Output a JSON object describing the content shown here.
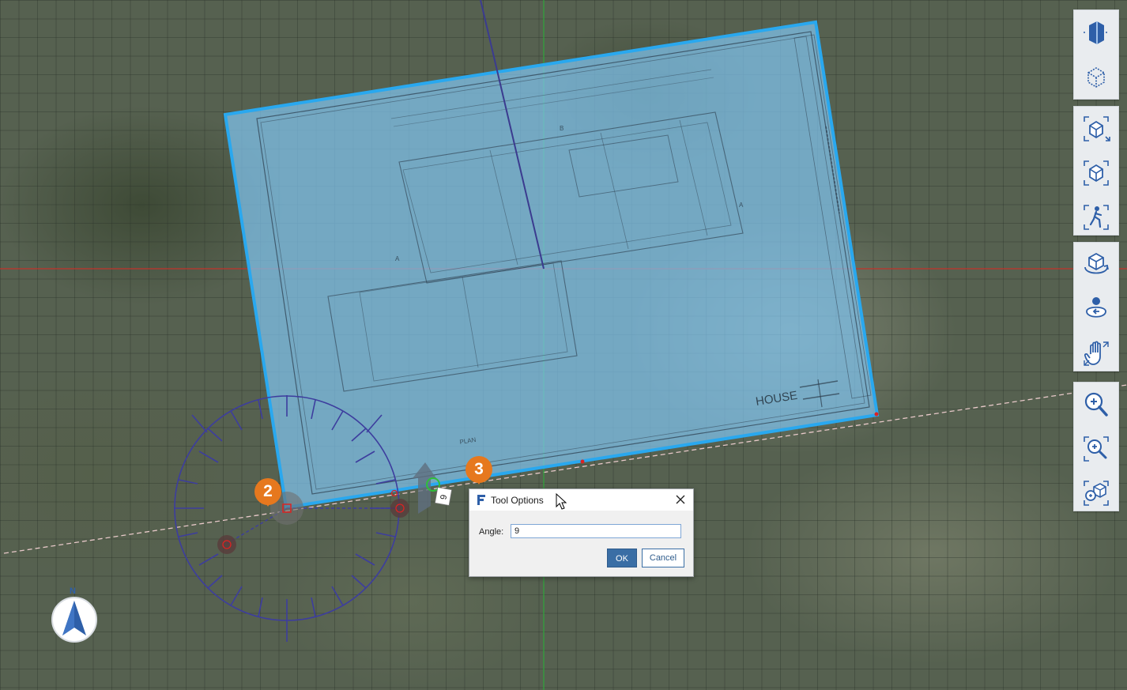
{
  "viewport": {
    "drawing_text": {
      "house_label": "HOUSE",
      "plan_label": "PLAN",
      "section_a_left": "A",
      "section_a_right": "A",
      "section_b": "B",
      "rotation_readout": "9"
    }
  },
  "callouts": [
    {
      "number": "2"
    },
    {
      "number": "3"
    }
  ],
  "compass": {
    "north_label": "N",
    "icon": "north-arrow-icon"
  },
  "toolbar": {
    "groups": [
      {
        "items": [
          {
            "name": "section-view-icon"
          },
          {
            "name": "visual-style-icon"
          }
        ]
      },
      {
        "items": [
          {
            "name": "fit-view-icon"
          },
          {
            "name": "home-view-icon"
          },
          {
            "name": "walk-icon"
          }
        ]
      },
      {
        "items": [
          {
            "name": "orbit-icon"
          },
          {
            "name": "look-around-icon"
          },
          {
            "name": "pan-hand-icon"
          }
        ]
      },
      {
        "items": [
          {
            "name": "zoom-icon"
          },
          {
            "name": "zoom-region-icon"
          },
          {
            "name": "zoom-selected-icon"
          }
        ]
      }
    ]
  },
  "dialog": {
    "title": "Tool Options",
    "angle_label": "Angle:",
    "angle_value": "9",
    "ok_label": "OK",
    "cancel_label": "Cancel"
  },
  "colors": {
    "overlay_fill": "#7fc4ee",
    "selection_edge": "#29a8ef",
    "x_axis": "#c2332b",
    "y_axis": "#2fa63b",
    "rotate_widget": "#3d3d9e",
    "callout": "#e6781e",
    "button_primary": "#3a6ea5"
  }
}
